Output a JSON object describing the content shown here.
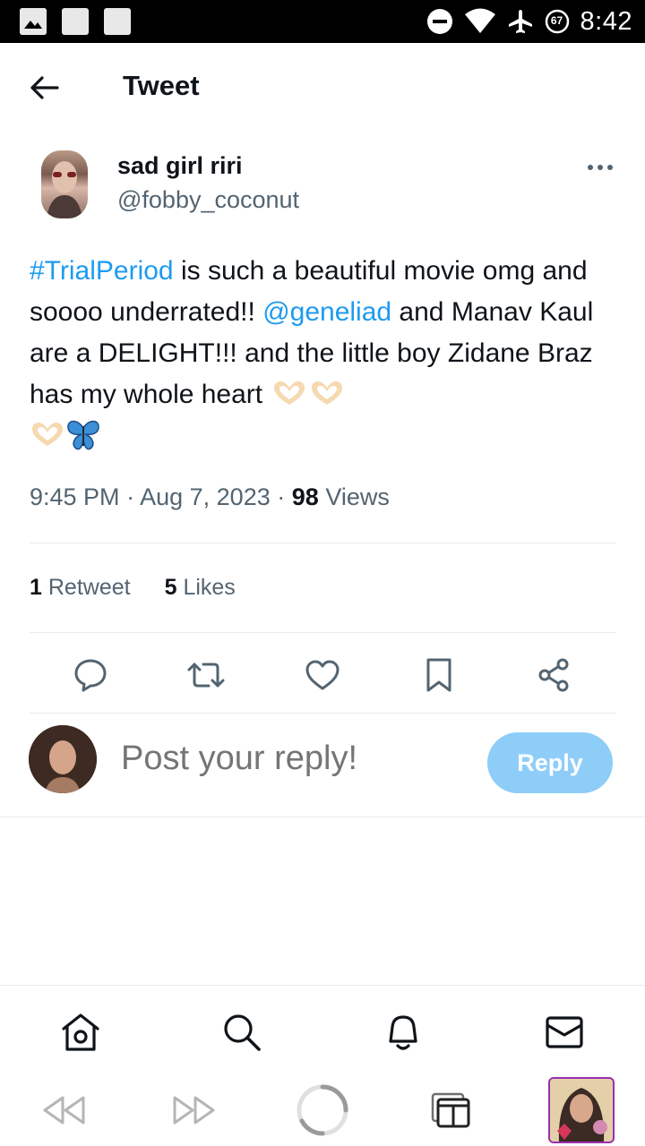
{
  "status_bar": {
    "time": "8:42",
    "battery_level": "67",
    "icons": [
      "image-icon",
      "square-icon",
      "square-icon",
      "do-not-disturb-icon",
      "wifi-icon",
      "airplane-icon",
      "battery-icon"
    ]
  },
  "header": {
    "title": "Tweet"
  },
  "tweet": {
    "author_name": "sad girl riri",
    "author_handle": "@fobby_coconut",
    "text": {
      "hashtag": "#TrialPeriod",
      "part1": " is such a beautiful movie omg and soooo underrated!! ",
      "mention": "@geneliad",
      "part2": " and Manav Kaul are a DELIGHT!!! and the little boy Zidane Braz has my whole heart "
    },
    "emojis": [
      "heart-hands",
      "heart-hands",
      "heart-hands",
      "butterfly"
    ],
    "time": "9:45 PM",
    "date": "Aug 7, 2023",
    "views_count": "98",
    "views_label": "Views",
    "separator": "·",
    "retweets_count": "1",
    "retweets_label": "Retweet",
    "likes_count": "5",
    "likes_label": "Likes"
  },
  "reply": {
    "placeholder": "Post your reply!",
    "button_label": "Reply"
  },
  "colors": {
    "link": "#1d9bf0",
    "reply_button": "#8ecdf8",
    "secondary_text": "#536471"
  },
  "bottom_nav": [
    "home-icon",
    "search-icon",
    "notifications-icon",
    "messages-icon"
  ],
  "browser_toolbar": [
    "back-icon",
    "forward-icon",
    "loading-icon",
    "tabs-icon",
    "profile-thumbnail"
  ]
}
